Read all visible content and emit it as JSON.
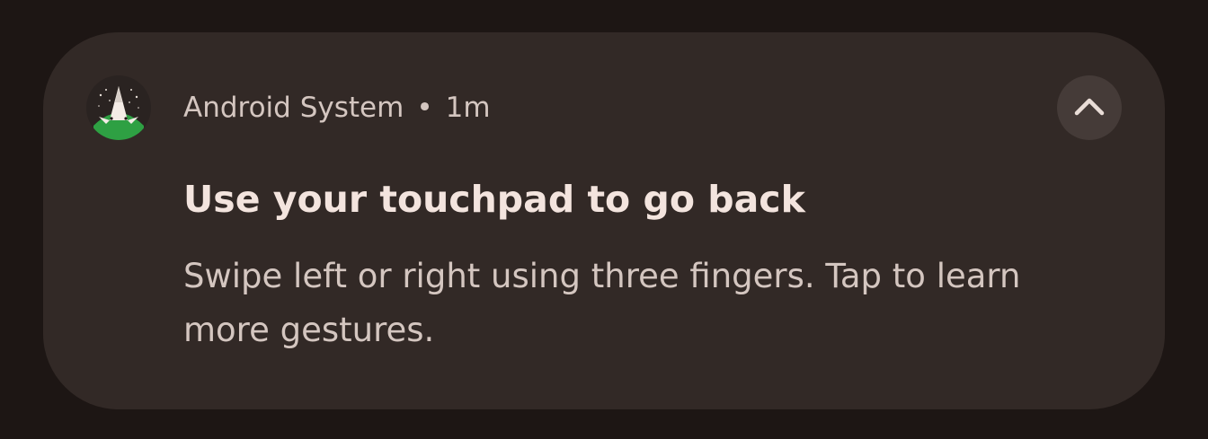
{
  "notification": {
    "app_name": "Android System",
    "separator": "•",
    "time": "1m",
    "title": "Use your touchpad to go back",
    "body": "Swipe left or right using three fingers. Tap to learn more gestures.",
    "app_icon": "android-rocket-icon",
    "expand_icon": "chevron-up-icon"
  },
  "colors": {
    "background": "#1d1614",
    "card": "#322926",
    "button": "#453b38",
    "title_text": "#f3e4de",
    "secondary_text": "#d4c6c0",
    "icon_green": "#2ea043"
  }
}
